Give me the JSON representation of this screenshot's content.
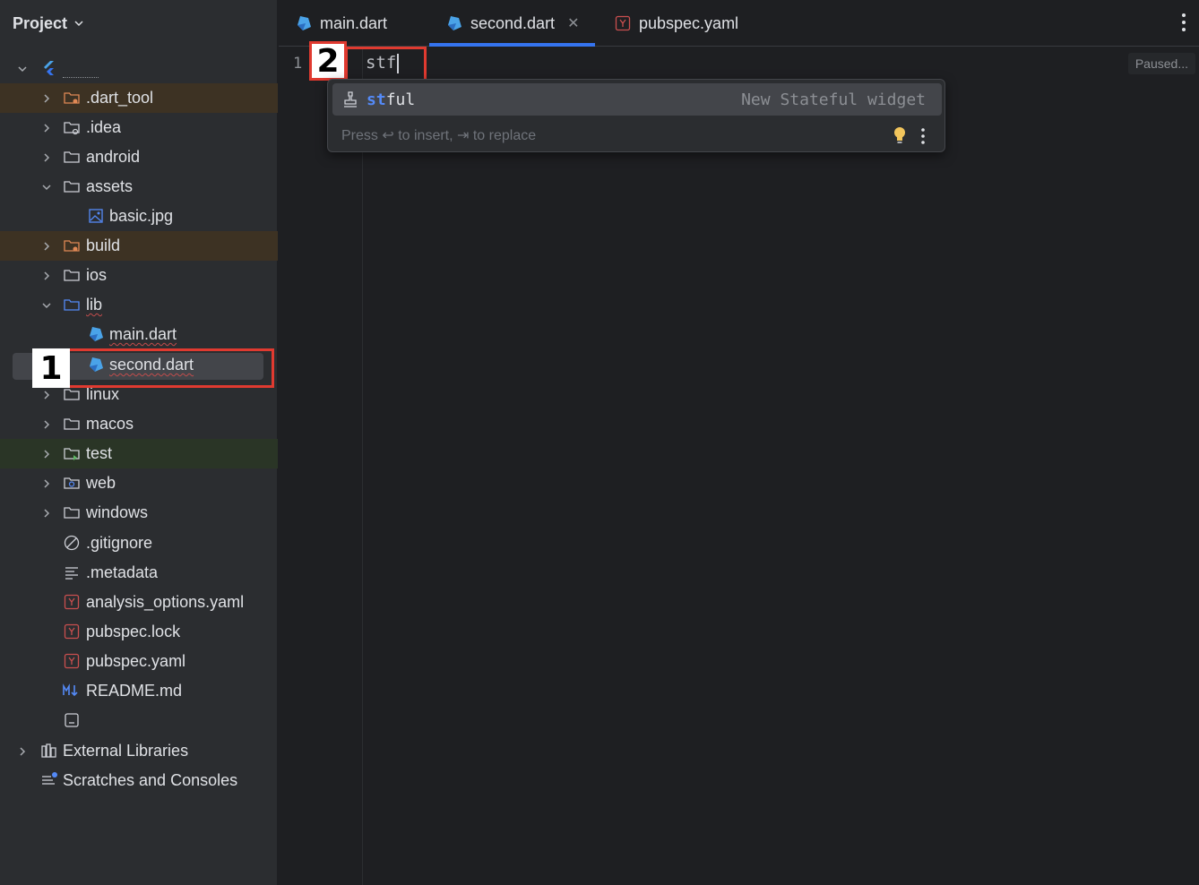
{
  "sidebar": {
    "title": "Project",
    "tree": [
      {
        "label": ".dart_tool",
        "icon": "folder-excluded-icon"
      },
      {
        "label": ".idea",
        "icon": "folder-settings-icon"
      },
      {
        "label": "android",
        "icon": "folder-icon"
      },
      {
        "label": "assets",
        "icon": "folder-icon"
      },
      {
        "label": "basic.jpg",
        "icon": "image-file-icon"
      },
      {
        "label": "build",
        "icon": "folder-excluded-icon"
      },
      {
        "label": "ios",
        "icon": "folder-icon"
      },
      {
        "label": "lib",
        "icon": "source-folder-icon"
      },
      {
        "label": "main.dart",
        "icon": "dart-file-icon"
      },
      {
        "label": "second.dart",
        "icon": "dart-file-icon"
      },
      {
        "label": "linux",
        "icon": "folder-icon"
      },
      {
        "label": "macos",
        "icon": "folder-icon"
      },
      {
        "label": "test",
        "icon": "test-folder-icon"
      },
      {
        "label": "web",
        "icon": "web-folder-icon"
      },
      {
        "label": "windows",
        "icon": "folder-icon"
      },
      {
        "label": ".gitignore",
        "icon": "ignore-file-icon"
      },
      {
        "label": ".metadata",
        "icon": "text-file-icon"
      },
      {
        "label": "analysis_options.yaml",
        "icon": "yaml-file-icon"
      },
      {
        "label": "pubspec.lock",
        "icon": "yaml-file-icon"
      },
      {
        "label": "pubspec.yaml",
        "icon": "yaml-file-icon"
      },
      {
        "label": "README.md",
        "icon": "markdown-file-icon"
      },
      {
        "label": "",
        "icon": "iml-file-icon"
      },
      {
        "label": "External Libraries",
        "icon": "libraries-icon"
      },
      {
        "label": "Scratches and Consoles",
        "icon": "scratches-icon"
      }
    ]
  },
  "tabs": [
    {
      "label": "main.dart",
      "icon": "dart-file-icon"
    },
    {
      "label": "second.dart",
      "icon": "dart-file-icon"
    },
    {
      "label": "pubspec.yaml",
      "icon": "yaml-file-icon"
    }
  ],
  "editor": {
    "line_number": "1",
    "code_text": "stf",
    "status": "Paused..."
  },
  "completion": {
    "item_match": "st",
    "item_rest": "ful",
    "item_desc": "New Stateful widget",
    "hint": "Press ↩ to insert, ⇥ to replace"
  },
  "callouts": {
    "one": "1",
    "two": "2"
  },
  "colors": {
    "accent": "#3574f0",
    "callout": "#e03a30",
    "dart": "#4aa3e8",
    "yaml": "#c94f4f"
  }
}
